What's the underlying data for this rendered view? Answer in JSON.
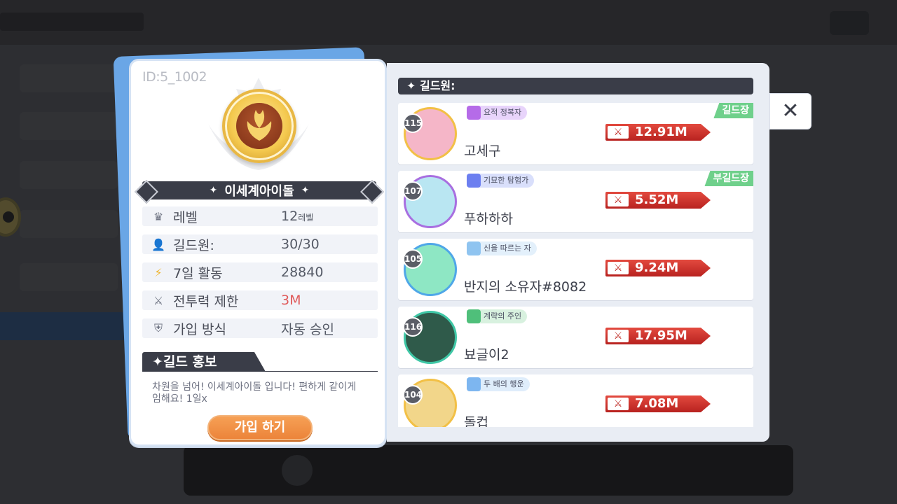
{
  "guild": {
    "id": "ID:5_1002",
    "name": "이세계아이돌",
    "stats": [
      {
        "icon": "crown-icon",
        "label": "레벨",
        "value": "12",
        "suffix": "레벨"
      },
      {
        "icon": "person-icon",
        "label": "길드원:",
        "value": "30/30"
      },
      {
        "icon": "lightning-icon",
        "label": "7일 활동",
        "value": "28840"
      },
      {
        "icon": "crossed-swords-icon",
        "label": "전투력 제한",
        "value": "3M"
      },
      {
        "icon": "shield-icon",
        "label": "가입 방식",
        "value": "자동 승인"
      }
    ],
    "promo_title": "길드 홍보",
    "promo_text": "차원을 넘어! 이세계아이돌 입니다! 편하게 같이게임해요! 1일x",
    "join_label": "가입 하기"
  },
  "members_title": "길드원:",
  "members": [
    {
      "level": "115",
      "title": "요적 정복자",
      "name": "고세구",
      "power": "12.91M",
      "rank": "길드장",
      "title_color": "#b56be8",
      "avatar_color": "#f5b6c8"
    },
    {
      "level": "107",
      "title": "기묘한 탐험가",
      "name": "푸하하하",
      "power": "5.52M",
      "rank": "부길드장",
      "title_color": "#6c7ff0",
      "avatar_color": "#b9e6f2"
    },
    {
      "level": "105",
      "title": "신을 따르는 자",
      "name": "반지의 소유자#8082",
      "power": "9.24M",
      "rank": "",
      "title_color": "#8fc4f0",
      "avatar_color": "#8ee7c4"
    },
    {
      "level": "116",
      "title": "계략의 주인",
      "name": "뵤글이2",
      "power": "17.95M",
      "rank": "",
      "title_color": "#4fbf7a",
      "avatar_color": "#2f5a4a"
    },
    {
      "level": "104",
      "title": "두 배의 행운",
      "name": "돌컵",
      "power": "7.08M",
      "rank": "",
      "title_color": "#7db6f0",
      "avatar_color": "#f2d68a"
    }
  ],
  "close_icon": "close-icon"
}
